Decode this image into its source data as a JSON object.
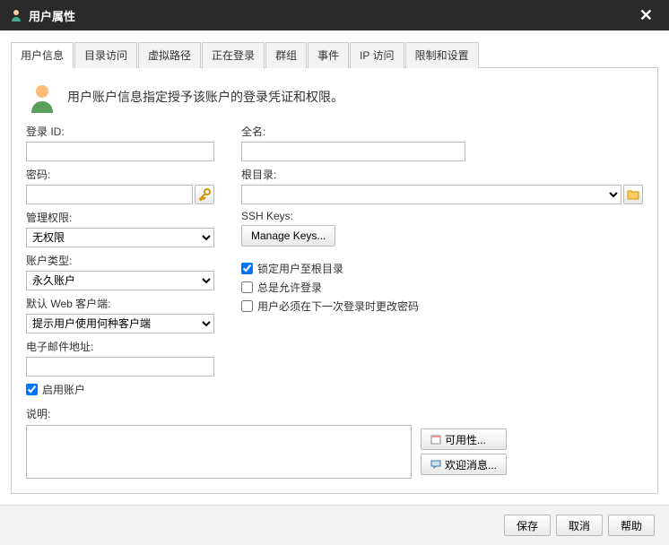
{
  "titlebar": {
    "title": "用户属性"
  },
  "tabs": [
    "用户信息",
    "目录访问",
    "虚拟路径",
    "正在登录",
    "群组",
    "事件",
    "IP 访问",
    "限制和设置"
  ],
  "intro": "用户账户信息指定授予该账户的登录凭证和权限。",
  "labels": {
    "loginId": "登录 ID:",
    "password": "密码:",
    "adminPriv": "管理权限:",
    "accountType": "账户类型:",
    "defaultWeb": "默认 Web 客户端:",
    "email": "电子邮件地址:",
    "fullName": "全名:",
    "rootDir": "根目录:",
    "sshKeys": "SSH Keys:",
    "description": "说明:"
  },
  "values": {
    "adminPriv": "无权限",
    "accountType": "永久账户",
    "defaultWeb": "提示用户使用何种客户端"
  },
  "buttons": {
    "manageKeys": "Manage Keys...",
    "availability": "可用性...",
    "welcomeMsg": "欢迎消息...",
    "save": "保存",
    "cancel": "取消",
    "help": "帮助"
  },
  "checkboxes": {
    "enableAccount": "启用账户",
    "lockRoot": "锁定用户至根目录",
    "alwaysAllow": "总是允许登录",
    "changePwNext": "用户必须在下一次登录时更改密码"
  }
}
